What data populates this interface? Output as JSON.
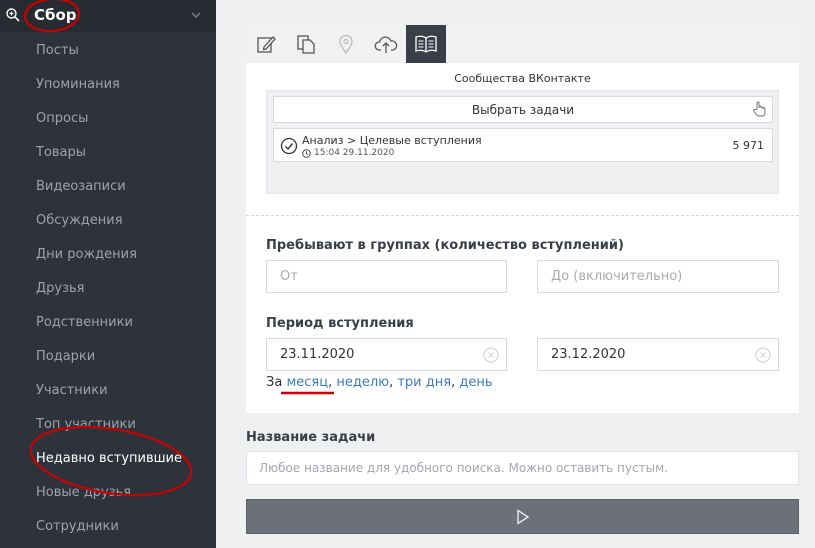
{
  "sidebar": {
    "header_title": "Сбор",
    "header_icon": "search-plus-icon",
    "chevron_icon": "chevron-down-icon",
    "items": [
      {
        "label": "Посты"
      },
      {
        "label": "Упоминания"
      },
      {
        "label": "Опросы"
      },
      {
        "label": "Товары"
      },
      {
        "label": "Видеозаписи"
      },
      {
        "label": "Обсуждения"
      },
      {
        "label": "Дни рождения"
      },
      {
        "label": "Друзья"
      },
      {
        "label": "Родственники"
      },
      {
        "label": "Подарки"
      },
      {
        "label": "Участники"
      },
      {
        "label": "Топ участники"
      },
      {
        "label": "Недавно вступившие",
        "active": true
      },
      {
        "label": "Новые друзья"
      },
      {
        "label": "Сотрудники"
      }
    ]
  },
  "toolbar": {
    "buttons": [
      "edit-icon",
      "copy-icon",
      "location-pin-icon",
      "cloud-upload-icon",
      "book-icon"
    ],
    "active_index": 4
  },
  "source": {
    "title": "Сообщества ВКонтакте",
    "pick_button": "Выбрать задачи",
    "task": {
      "name": "Анализ > Целевые вступления",
      "time": "15:04 29.11.2020",
      "count": "5 971"
    }
  },
  "filters": {
    "groups_label": "Пребывают в группах (количество вступлений)",
    "from_placeholder": "От",
    "to_placeholder": "До (включительно)",
    "period_label": "Период вступления",
    "date_from": "23.11.2020",
    "date_to": "23.12.2020",
    "period_prefix": "За",
    "period_links": [
      "месяц",
      "неделю",
      "три дня",
      "день"
    ]
  },
  "task_form": {
    "name_label": "Название задачи",
    "name_placeholder": "Любое название для удобного поиска. Можно оставить пустым."
  },
  "colors": {
    "sidebar_bg": "#2e333b",
    "accent_link": "#3a7bc1",
    "annotation": "#cc0000",
    "run_button": "#6b7079"
  }
}
